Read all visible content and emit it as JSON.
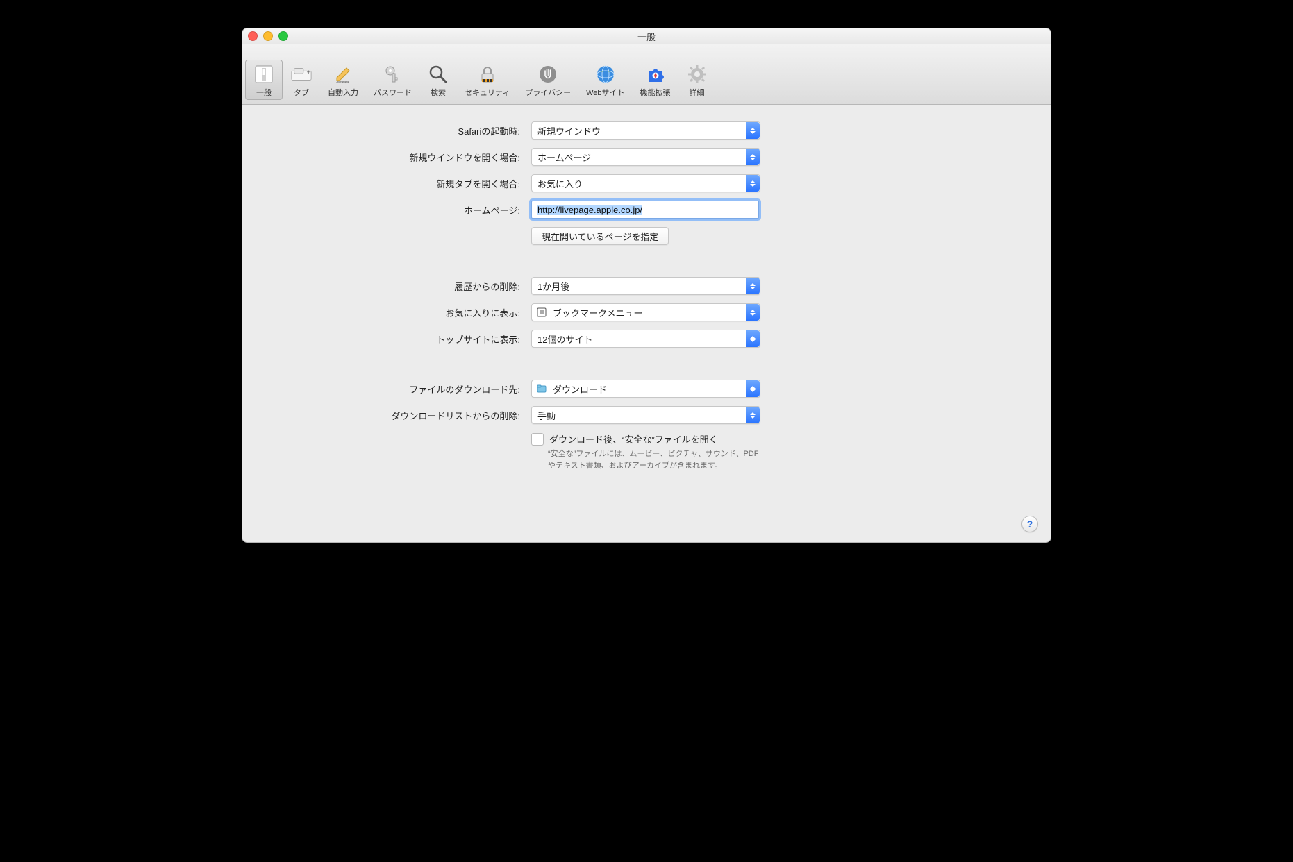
{
  "window": {
    "title": "一般"
  },
  "toolbar": {
    "items": [
      {
        "id": "general",
        "label": "一般",
        "selected": true
      },
      {
        "id": "tabs",
        "label": "タブ",
        "selected": false
      },
      {
        "id": "autofill",
        "label": "自動入力",
        "selected": false
      },
      {
        "id": "passwords",
        "label": "パスワード",
        "selected": false
      },
      {
        "id": "search",
        "label": "検索",
        "selected": false
      },
      {
        "id": "security",
        "label": "セキュリティ",
        "selected": false
      },
      {
        "id": "privacy",
        "label": "プライバシー",
        "selected": false
      },
      {
        "id": "websites",
        "label": "Webサイト",
        "selected": false
      },
      {
        "id": "extensions",
        "label": "機能拡張",
        "selected": false
      },
      {
        "id": "advanced",
        "label": "詳細",
        "selected": false
      }
    ]
  },
  "form": {
    "startup": {
      "label": "Safariの起動時:",
      "value": "新規ウインドウ"
    },
    "new_window": {
      "label": "新規ウインドウを開く場合:",
      "value": "ホームページ"
    },
    "new_tab": {
      "label": "新規タブを開く場合:",
      "value": "お気に入り"
    },
    "homepage": {
      "label": "ホームページ:",
      "value": "http://livepage.apple.co.jp/"
    },
    "set_current": {
      "label": "現在開いているページを指定"
    },
    "history_remove": {
      "label": "履歴からの削除:",
      "value": "1か月後"
    },
    "fav_show": {
      "label": "お気に入りに表示:",
      "value": "ブックマークメニュー"
    },
    "topsites": {
      "label": "トップサイトに表示:",
      "value": "12個のサイト"
    },
    "download_loc": {
      "label": "ファイルのダウンロード先:",
      "value": "ダウンロード"
    },
    "download_remove": {
      "label": "ダウンロードリストからの削除:",
      "value": "手動"
    },
    "open_safe": {
      "label": "ダウンロード後、“安全な”ファイルを開く",
      "help": "“安全な”ファイルには、ムービー、ピクチャ、サウンド、PDFやテキスト書類、およびアーカイブが含まれます。"
    }
  },
  "help_button": "?"
}
